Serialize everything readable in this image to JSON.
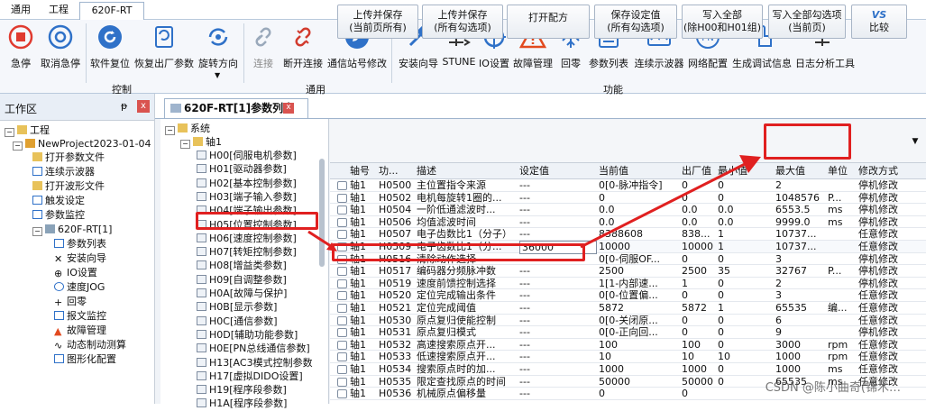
{
  "tabs": [
    "通用",
    "工程",
    "620F-RT"
  ],
  "ribbon": {
    "buttons": [
      "急停",
      "取消急停",
      "软件复位",
      "恢复出厂参数",
      "旋转方向",
      "连接",
      "断开连接",
      "通信站号修改",
      "安装向导",
      "STUNE",
      "IO设置",
      "故障管理",
      "回零",
      "参数列表",
      "连续示波器",
      "网络配置",
      "生成调试信息",
      "日志分析工具"
    ],
    "groups": [
      "控制",
      "通用",
      "功能"
    ]
  },
  "left_panel": {
    "title": "工作区",
    "pin": "ᵽ",
    "close": "x",
    "items": [
      "工程",
      "NewProject2023-01-04",
      "打开参数文件",
      "连续示波器",
      "打开波形文件",
      "触发设定",
      "参数监控",
      "620F-RT[1]",
      "参数列表",
      "安装向导",
      "IO设置",
      "速度JOG",
      "回零",
      "报文监控",
      "故障管理",
      "动态制动测算",
      "图形化配置"
    ]
  },
  "doc_tab": {
    "title": "620F-RT[1]参数列表",
    "close": "x"
  },
  "param_tree": {
    "root": "系统",
    "axis": "轴1",
    "groups": [
      "H00[伺服电机参数]",
      "H01[驱动器参数]",
      "H02[基本控制参数]",
      "H03[端子输入参数]",
      "H04[端子输出参数]",
      "H05[位置控制参数]",
      "H06[速度控制参数]",
      "H07[转矩控制参数]",
      "H08[增益类参数]",
      "H09[自调整参数]",
      "H0A[故障与保护]",
      "H0B[显示参数]",
      "H0C[通信参数]",
      "H0D[辅助功能参数]",
      "H0E[PN总线通信参数]",
      "H13[AC3模式控制参数",
      "H17[虚拟DIDO设置]",
      "H19[程序段参数]",
      "H1A[程序段参数]"
    ]
  },
  "toolbar": {
    "buttons": [
      {
        "line1": "上传并保存",
        "line2": "(当前页所有)"
      },
      {
        "line1": "上传并保存",
        "line2": "(所有勾选项)"
      },
      {
        "line1": "打开配方",
        "line2": ""
      },
      {
        "line1": "保存设定值",
        "line2": "(所有勾选项)"
      },
      {
        "line1": "写入全部",
        "line2": "(除H00和H01组)"
      },
      {
        "line1": "写入全部勾选项",
        "line2": "(当前页)"
      }
    ],
    "compare": "比较",
    "compare_icon": "VS"
  },
  "table": {
    "columns": [
      "轴号",
      "功...",
      "描述",
      "设定值",
      "当前值",
      "出厂值",
      "最小值",
      "最大值",
      "单位",
      "修改方式"
    ],
    "rows": [
      [
        "轴1",
        "H0500",
        "主位置指令来源",
        "---",
        "0[0-脉冲指令]",
        "0",
        "0",
        "2",
        "",
        "停机修改"
      ],
      [
        "轴1",
        "H0502",
        "电机每旋转1圈的...",
        "---",
        "0",
        "0",
        "0",
        "1048576",
        "P...",
        "停机修改"
      ],
      [
        "轴1",
        "H0504",
        "一阶低通滤波时...",
        "---",
        "0.0",
        "0.0",
        "0.0",
        "6553.5",
        "ms",
        "停机修改"
      ],
      [
        "轴1",
        "H0506",
        "均值滤波时间",
        "---",
        "0.0",
        "0.0",
        "0.0",
        "9999.0",
        "ms",
        "停机修改"
      ],
      [
        "轴1",
        "H0507",
        "电子齿数比1（分子）",
        "---",
        "8388608",
        "838...",
        "1",
        "10737...",
        "",
        "任意修改"
      ],
      [
        "轴1",
        "H0509",
        "电子齿数比1（分...",
        "36000",
        "10000",
        "10000",
        "1",
        "10737...",
        "",
        "任意修改"
      ],
      [
        "轴1",
        "H0516",
        "清除动作选择",
        "---",
        "0[0-伺服OF...",
        "0",
        "0",
        "3",
        "",
        "停机修改"
      ],
      [
        "轴1",
        "H0517",
        "编码器分频脉冲数",
        "---",
        "2500",
        "2500",
        "35",
        "32767",
        "P...",
        "停机修改"
      ],
      [
        "轴1",
        "H0519",
        "速度前馈控制选择",
        "---",
        "1[1-内部速...",
        "1",
        "0",
        "2",
        "",
        "停机修改"
      ],
      [
        "轴1",
        "H0520",
        "定位完成输出条件",
        "---",
        "0[0-位置偏...",
        "0",
        "0",
        "3",
        "",
        "任意修改"
      ],
      [
        "轴1",
        "H0521",
        "定位完成阈值",
        "---",
        "5872",
        "5872",
        "1",
        "65535",
        "编...",
        "任意修改"
      ],
      [
        "轴1",
        "H0530",
        "原点复归使能控制",
        "---",
        "0[0-关闭原...",
        "0",
        "0",
        "6",
        "",
        "任意修改"
      ],
      [
        "轴1",
        "H0531",
        "原点复归模式",
        "---",
        "0[0-正向回...",
        "0",
        "0",
        "9",
        "",
        "停机修改"
      ],
      [
        "轴1",
        "H0532",
        "高速搜索原点开...",
        "---",
        "100",
        "100",
        "0",
        "3000",
        "rpm",
        "任意修改"
      ],
      [
        "轴1",
        "H0533",
        "低速搜索原点开...",
        "---",
        "10",
        "10",
        "10",
        "1000",
        "rpm",
        "任意修改"
      ],
      [
        "轴1",
        "H0534",
        "搜索原点时的加...",
        "---",
        "1000",
        "1000",
        "0",
        "1000",
        "ms",
        "任意修改"
      ],
      [
        "轴1",
        "H0535",
        "限定查找原点的时间",
        "---",
        "50000",
        "50000",
        "0",
        "65535",
        "ms",
        "任意修改"
      ],
      [
        "轴1",
        "H0536",
        "机械原点偏移量",
        "---",
        "0",
        "0",
        "",
        "",
        "",
        ""
      ]
    ]
  },
  "watermark": "CSDN @陈小曲奇(锦木…"
}
